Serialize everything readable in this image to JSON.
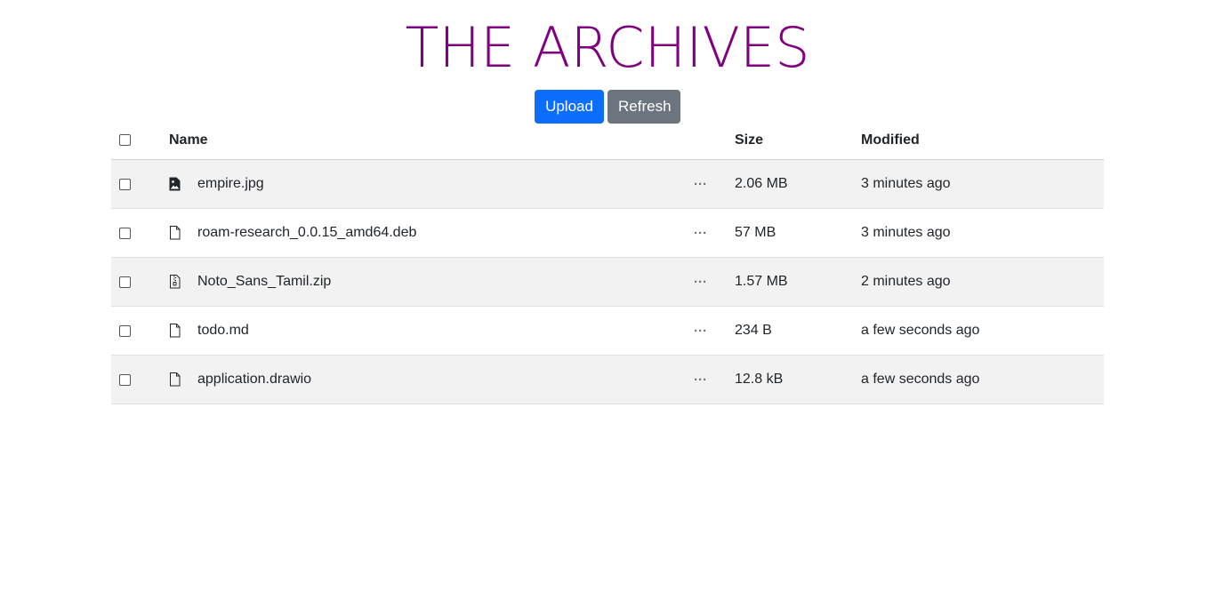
{
  "header": {
    "title": "THE ARCHIVES"
  },
  "toolbar": {
    "upload_label": "Upload",
    "refresh_label": "Refresh"
  },
  "table": {
    "columns": {
      "name": "Name",
      "size": "Size",
      "modified": "Modified"
    },
    "rows": [
      {
        "name": "empire.jpg",
        "size": "2.06 MB",
        "modified": "3 minutes ago",
        "icon": "image-file-icon"
      },
      {
        "name": "roam-research_0.0.15_amd64.deb",
        "size": "57 MB",
        "modified": "3 minutes ago",
        "icon": "file-icon"
      },
      {
        "name": "Noto_Sans_Tamil.zip",
        "size": "1.57 MB",
        "modified": "2 minutes ago",
        "icon": "zip-file-icon"
      },
      {
        "name": "todo.md",
        "size": "234 B",
        "modified": "a few seconds ago",
        "icon": "file-icon"
      },
      {
        "name": "application.drawio",
        "size": "12.8 kB",
        "modified": "a few seconds ago",
        "icon": "file-icon"
      }
    ],
    "more_glyph": "···"
  },
  "colors": {
    "title": "#800080",
    "primary": "#0d6efd",
    "secondary": "#6c757d",
    "stripe": "#f2f2f2"
  }
}
